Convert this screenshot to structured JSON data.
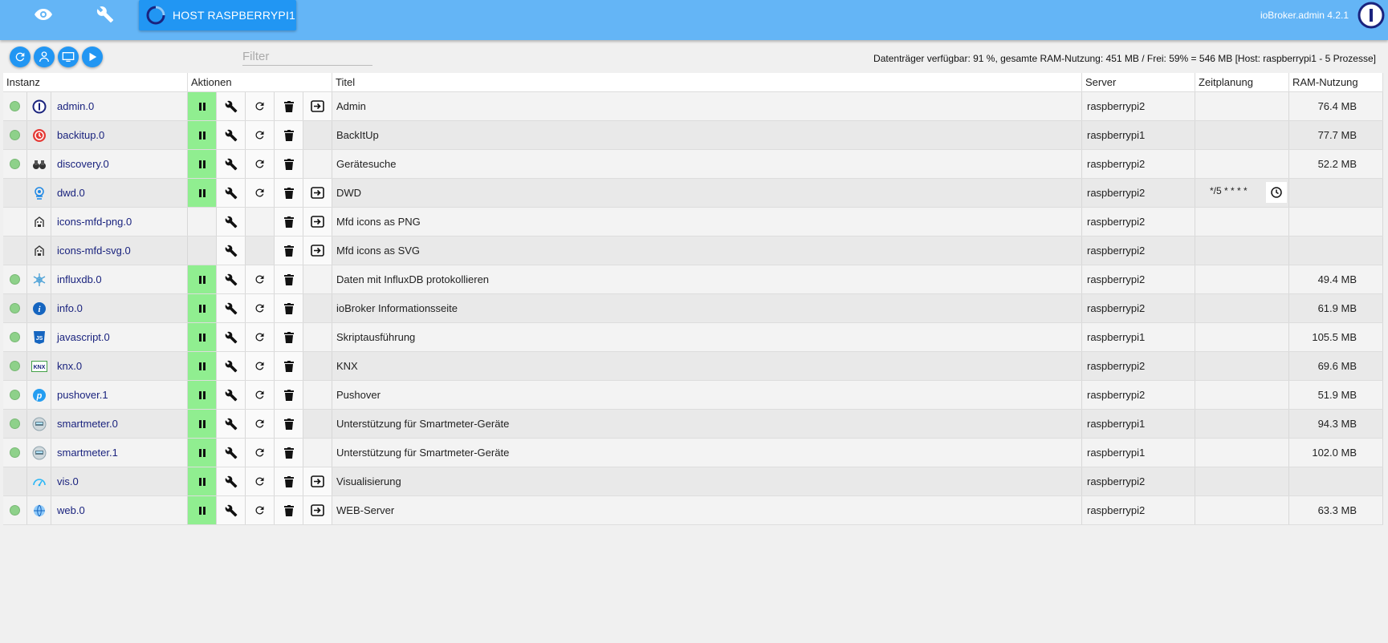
{
  "topbar": {
    "host_label": "HOST RASPBERRYPI1",
    "version": "ioBroker.admin 4.2.1",
    "tabs": [
      {
        "icon": "eye-icon"
      },
      {
        "icon": "wrench-icon"
      }
    ]
  },
  "toolbar": {
    "buttons": [
      {
        "icon": "refresh-icon"
      },
      {
        "icon": "expert-mode-icon"
      },
      {
        "icon": "monitor-icon"
      },
      {
        "icon": "play-icon"
      }
    ],
    "filter_placeholder": "Filter",
    "stats": "Datenträger verfügbar: 91 %, gesamte RAM-Nutzung: 451 MB / Frei: 59% = 546 MB [Host: raspberrypi1 - 5 Prozesse]"
  },
  "table": {
    "headers": {
      "instance": "Instanz",
      "actions": "Aktionen",
      "title": "Titel",
      "server": "Server",
      "schedule": "Zeitplanung",
      "ram": "RAM-Nutzung"
    },
    "rows": [
      {
        "status": true,
        "icon": "admin-icon",
        "name": "admin.0",
        "pause": true,
        "restart": true,
        "link": true,
        "title": "Admin",
        "server": "raspberrypi2",
        "schedule": "",
        "ram": "76.4 MB"
      },
      {
        "status": true,
        "icon": "backitup-icon",
        "name": "backitup.0",
        "pause": true,
        "restart": true,
        "link": false,
        "title": "BackItUp",
        "server": "raspberrypi1",
        "schedule": "",
        "ram": "77.7 MB"
      },
      {
        "status": true,
        "icon": "binoculars-icon",
        "name": "discovery.0",
        "pause": true,
        "restart": true,
        "link": false,
        "title": "Gerätesuche",
        "server": "raspberrypi2",
        "schedule": "",
        "ram": "52.2 MB"
      },
      {
        "status": false,
        "icon": "dwd-icon",
        "name": "dwd.0",
        "pause": true,
        "restart": true,
        "link": true,
        "title": "DWD",
        "server": "raspberrypi2",
        "schedule": "*/5 * * * *",
        "ram": ""
      },
      {
        "status": false,
        "icon": "icons-mfd-icon",
        "name": "icons-mfd-png.0",
        "pause": false,
        "restart": false,
        "link": true,
        "title": "Mfd icons as PNG",
        "server": "raspberrypi2",
        "schedule": "",
        "ram": ""
      },
      {
        "status": false,
        "icon": "icons-mfd-icon",
        "name": "icons-mfd-svg.0",
        "pause": false,
        "restart": false,
        "link": true,
        "title": "Mfd icons as SVG",
        "server": "raspberrypi2",
        "schedule": "",
        "ram": ""
      },
      {
        "status": true,
        "icon": "influxdb-icon",
        "name": "influxdb.0",
        "pause": true,
        "restart": true,
        "link": false,
        "title": "Daten mit InfluxDB protokollieren",
        "server": "raspberrypi2",
        "schedule": "",
        "ram": "49.4 MB"
      },
      {
        "status": true,
        "icon": "info-icon",
        "name": "info.0",
        "pause": true,
        "restart": true,
        "link": false,
        "title": "ioBroker Informationsseite",
        "server": "raspberrypi2",
        "schedule": "",
        "ram": "61.9 MB"
      },
      {
        "status": true,
        "icon": "javascript-icon",
        "name": "javascript.0",
        "pause": true,
        "restart": true,
        "link": false,
        "title": "Skriptausführung",
        "server": "raspberrypi1",
        "schedule": "",
        "ram": "105.5 MB"
      },
      {
        "status": true,
        "icon": "knx-icon",
        "name": "knx.0",
        "pause": true,
        "restart": true,
        "link": false,
        "title": "KNX",
        "server": "raspberrypi2",
        "schedule": "",
        "ram": "69.6 MB"
      },
      {
        "status": true,
        "icon": "pushover-icon",
        "name": "pushover.1",
        "pause": true,
        "restart": true,
        "link": false,
        "title": "Pushover",
        "server": "raspberrypi2",
        "schedule": "",
        "ram": "51.9 MB"
      },
      {
        "status": true,
        "icon": "smartmeter-icon",
        "name": "smartmeter.0",
        "pause": true,
        "restart": true,
        "link": false,
        "title": "Unterstützung für Smartmeter-Geräte",
        "server": "raspberrypi1",
        "schedule": "",
        "ram": "94.3 MB"
      },
      {
        "status": true,
        "icon": "smartmeter-icon",
        "name": "smartmeter.1",
        "pause": true,
        "restart": true,
        "link": false,
        "title": "Unterstützung für Smartmeter-Geräte",
        "server": "raspberrypi1",
        "schedule": "",
        "ram": "102.0 MB"
      },
      {
        "status": false,
        "icon": "vis-icon",
        "name": "vis.0",
        "pause": true,
        "restart": true,
        "link": true,
        "title": "Visualisierung",
        "server": "raspberrypi2",
        "schedule": "",
        "ram": ""
      },
      {
        "status": true,
        "icon": "web-icon",
        "name": "web.0",
        "pause": true,
        "restart": true,
        "link": true,
        "title": "WEB-Server",
        "server": "raspberrypi2",
        "schedule": "",
        "ram": "63.3 MB"
      }
    ]
  },
  "colors": {
    "topbar": "#64b5f6",
    "accent": "#2196f3",
    "running": "#90ee90",
    "status_ok": "#8ed18a"
  }
}
